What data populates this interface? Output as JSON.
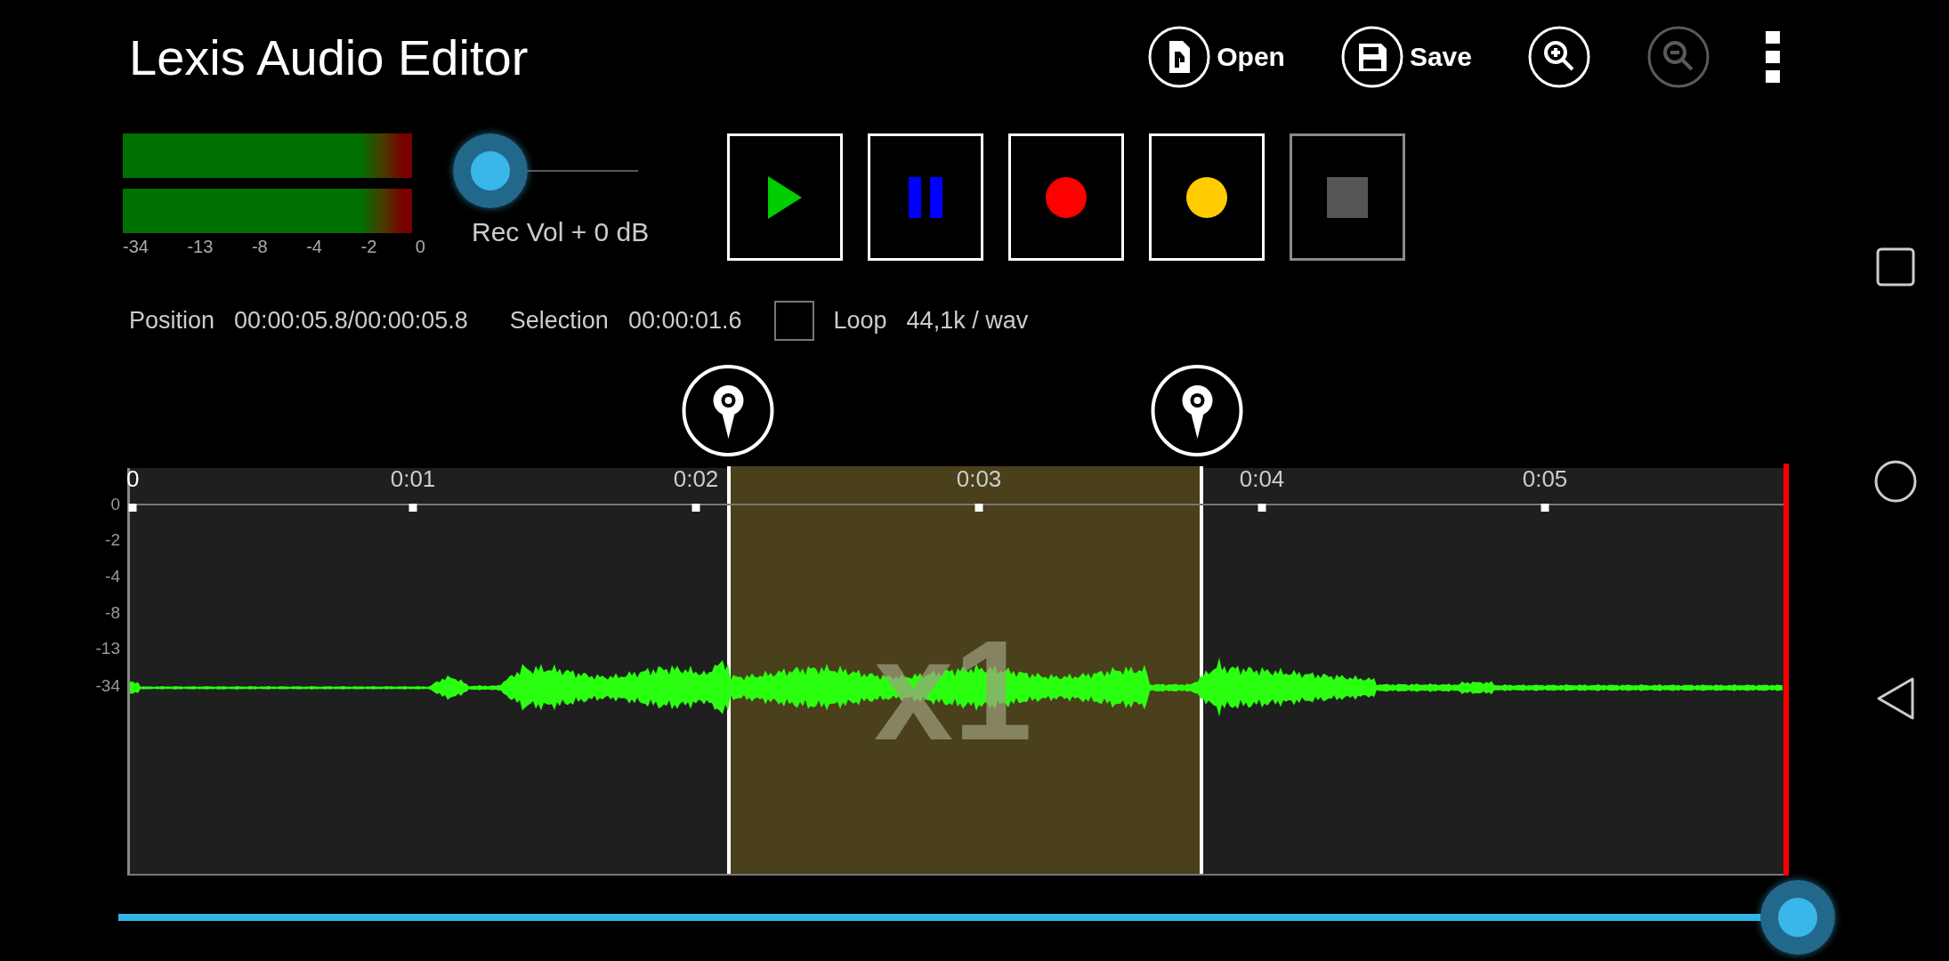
{
  "app_bar": {
    "title": "Lexis Audio Editor",
    "actions": [
      {
        "kind": "open",
        "label": "Open",
        "disabled": false
      },
      {
        "kind": "save",
        "label": "Save",
        "disabled": false
      },
      {
        "kind": "zoom_in",
        "disabled": false
      },
      {
        "kind": "zoom_out",
        "disabled": true
      },
      {
        "kind": "more",
        "disabled": false
      }
    ]
  },
  "meters": {
    "channels": [
      {
        "level": 1
      },
      {
        "level": 1
      }
    ],
    "scale": [
      "-34",
      "-13",
      "-8",
      "-4",
      "-2",
      "0"
    ]
  },
  "rec_volume": {
    "level": 0,
    "label": "Rec Vol + 0 dB"
  },
  "transport": [
    {
      "kind": "play",
      "disabled": false
    },
    {
      "kind": "pause",
      "disabled": false
    },
    {
      "kind": "record",
      "disabled": false
    },
    {
      "kind": "overdub",
      "disabled": false
    },
    {
      "kind": "stop",
      "disabled": true
    }
  ],
  "info": {
    "position_label": "Position",
    "position": "00:00:05.8/00:00:05.8",
    "selection_label": "Selection",
    "selection": "00:00:01.6",
    "loop": {
      "label": "Loop",
      "checked": false
    },
    "format": "44,1k / wav"
  },
  "waveform": {
    "time_ticks": [
      "0",
      "0:01",
      "0:02",
      "0:03",
      "0:04",
      "0:05"
    ],
    "db_ticks": [
      "0",
      "-2",
      "-4",
      "-8",
      "-13",
      "-34"
    ],
    "zoom_label": "x1"
  },
  "scrubber": {
    "level": 1
  }
}
